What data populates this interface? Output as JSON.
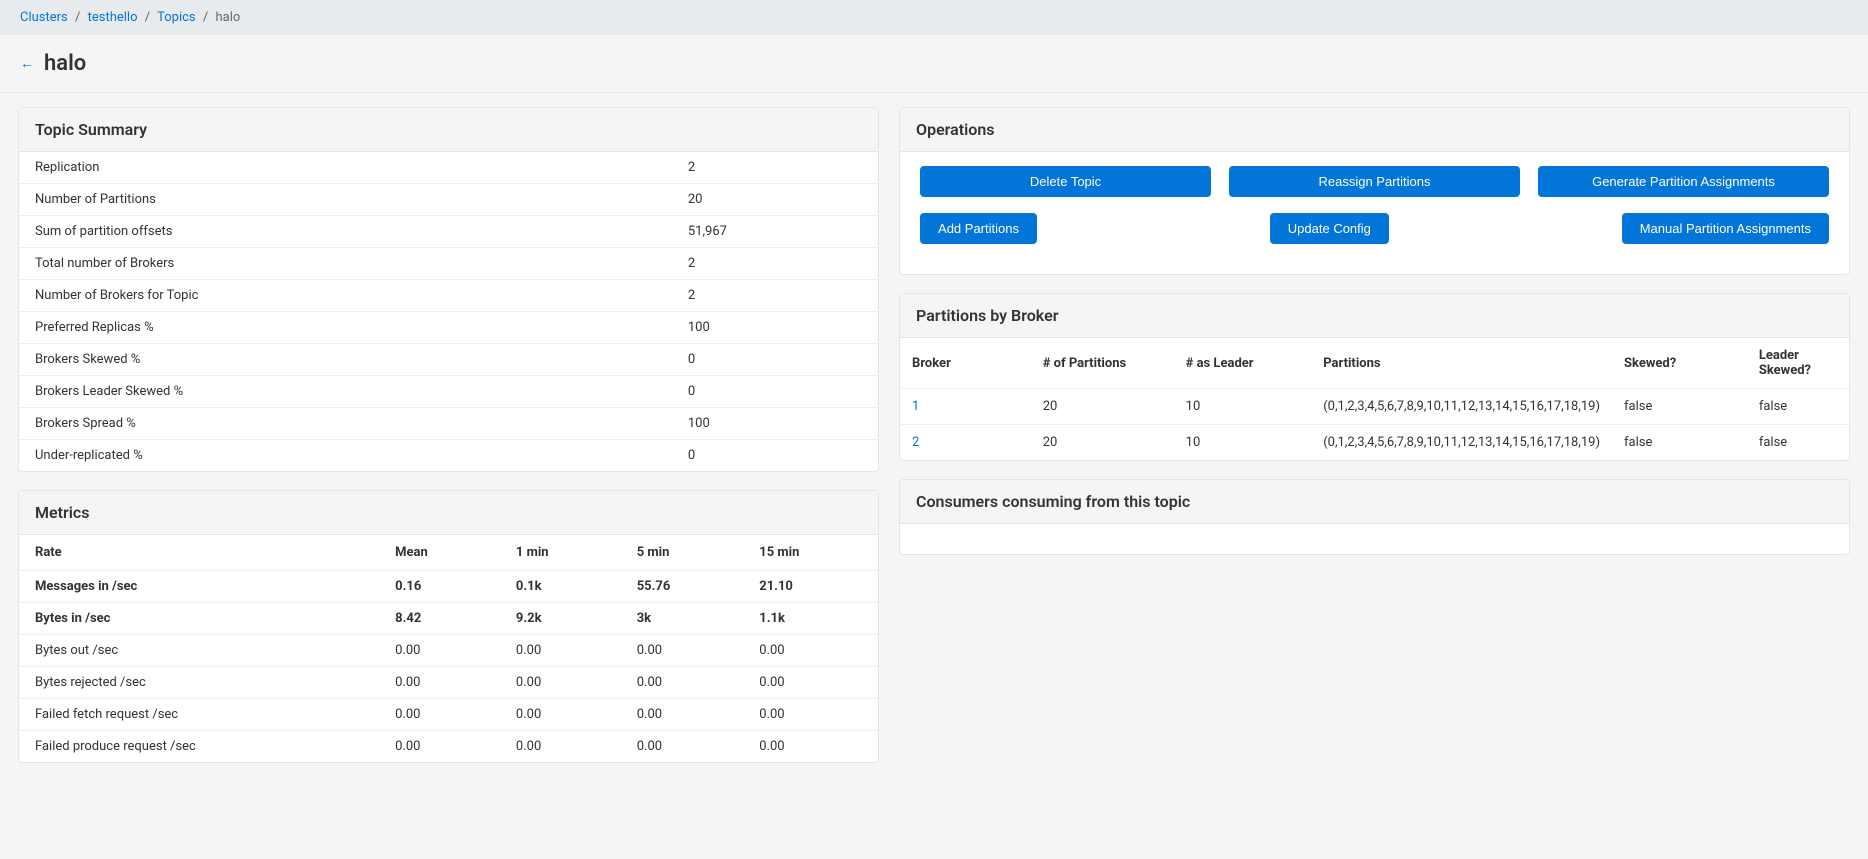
{
  "breadcrumb": {
    "items": [
      {
        "label": "Clusters",
        "link": true
      },
      {
        "label": "testhello",
        "link": true
      },
      {
        "label": "Topics",
        "link": true
      },
      {
        "label": "halo",
        "link": false
      }
    ]
  },
  "header": {
    "title": "halo"
  },
  "topic_summary": {
    "title": "Topic Summary",
    "rows": [
      {
        "label": "Replication",
        "value": "2"
      },
      {
        "label": "Number of Partitions",
        "value": "20"
      },
      {
        "label": "Sum of partition offsets",
        "value": "51,967"
      },
      {
        "label": "Total number of Brokers",
        "value": "2"
      },
      {
        "label": "Number of Brokers for Topic",
        "value": "2"
      },
      {
        "label": "Preferred Replicas %",
        "value": "100"
      },
      {
        "label": "Brokers Skewed %",
        "value": "0"
      },
      {
        "label": "Brokers Leader Skewed %",
        "value": "0"
      },
      {
        "label": "Brokers Spread %",
        "value": "100"
      },
      {
        "label": "Under-replicated %",
        "value": "0"
      }
    ]
  },
  "metrics": {
    "title": "Metrics",
    "headers": [
      "Rate",
      "Mean",
      "1 min",
      "5 min",
      "15 min"
    ],
    "rows": [
      {
        "rate": "Messages in /sec",
        "mean": "0.16",
        "m1": "0.1k",
        "m5": "55.76",
        "m15": "21.10"
      },
      {
        "rate": "Bytes in /sec",
        "mean": "8.42",
        "m1": "9.2k",
        "m5": "3k",
        "m15": "1.1k"
      },
      {
        "rate": "Bytes out /sec",
        "mean": "0.00",
        "m1": "0.00",
        "m5": "0.00",
        "m15": "0.00"
      },
      {
        "rate": "Bytes rejected /sec",
        "mean": "0.00",
        "m1": "0.00",
        "m5": "0.00",
        "m15": "0.00"
      },
      {
        "rate": "Failed fetch request /sec",
        "mean": "0.00",
        "m1": "0.00",
        "m5": "0.00",
        "m15": "0.00"
      },
      {
        "rate": "Failed produce request /sec",
        "mean": "0.00",
        "m1": "0.00",
        "m5": "0.00",
        "m15": "0.00"
      }
    ]
  },
  "operations": {
    "title": "Operations",
    "row1": [
      {
        "label": "Delete Topic"
      },
      {
        "label": "Reassign Partitions"
      },
      {
        "label": "Generate Partition Assignments"
      }
    ],
    "row2": [
      {
        "label": "Add Partitions"
      },
      {
        "label": "Update Config"
      },
      {
        "label": "Manual Partition Assignments"
      }
    ]
  },
  "partitions_by_broker": {
    "title": "Partitions by Broker",
    "headers": [
      "Broker",
      "# of Partitions",
      "# as Leader",
      "Partitions",
      "Skewed?",
      "Leader Skewed?"
    ],
    "rows": [
      {
        "broker": "1",
        "num_partitions": "20",
        "as_leader": "10",
        "partitions": "(0,1,2,3,4,5,6,7,8,9,10,11,12,13,14,15,16,17,18,19)",
        "skewed": "false",
        "leader_skewed": "false"
      },
      {
        "broker": "2",
        "num_partitions": "20",
        "as_leader": "10",
        "partitions": "(0,1,2,3,4,5,6,7,8,9,10,11,12,13,14,15,16,17,18,19)",
        "skewed": "false",
        "leader_skewed": "false"
      }
    ]
  },
  "consumers": {
    "title": "Consumers consuming from this topic"
  }
}
